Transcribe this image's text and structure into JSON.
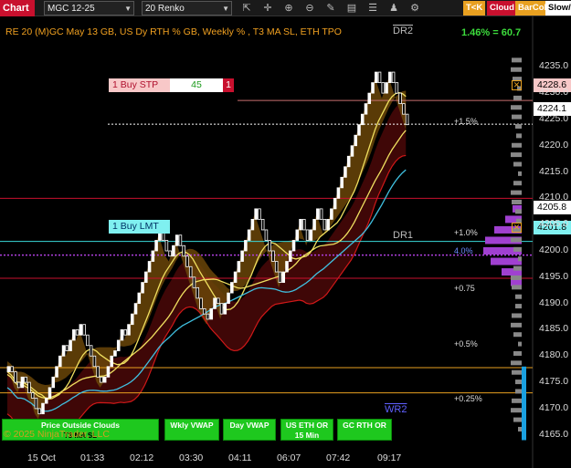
{
  "toolbar": {
    "chart_label": "Chart",
    "instrument": "MGC 12-25",
    "bar_type": "20 Renko",
    "icons": [
      "cursor-icon",
      "crosshair-icon",
      "draw-icon",
      "zoom-in-icon",
      "zoom-out-icon",
      "properties-icon",
      "list-icon",
      "strategy-icon",
      "settings-icon"
    ],
    "tk_label": "T<K",
    "cloud_label": "Cloud",
    "barcol_label": "BarCol",
    "slow_label": "Slow/I",
    "colors": {
      "chart": "#c8102e",
      "tk": "#e8a020",
      "cloud": "#c8102e",
      "barcol": "#e8a020"
    }
  },
  "header": {
    "title": "RE 20  (M)GC May 13 GB, US Dy RTH % GB, Weekly % , T3 MA SL, ETH TPO",
    "dr2": "DR2",
    "performance": "1.46% = 60.7"
  },
  "orders": {
    "buy_stop": {
      "label": "1 Buy STP",
      "qty": "45",
      "close": "1",
      "price": "4228.6"
    },
    "buy_limit": {
      "label": "1 Buy LMT",
      "price": "4201.8"
    }
  },
  "price_tags": {
    "last": "4224.1",
    "level_4205": "4205.8"
  },
  "y_axis": {
    "labels": [
      "4235.0",
      "4230.0",
      "4225.0",
      "4220.0",
      "4215.0",
      "4210.0",
      "4205.0",
      "4200.0",
      "4195.0",
      "4190.0",
      "4185.0",
      "4180.0",
      "4175.0",
      "4170.0",
      "4165.0"
    ],
    "min": 4162,
    "max": 4238
  },
  "x_axis": {
    "labels": [
      "15 Oct",
      "01:33",
      "02:12",
      "03:30",
      "04:11",
      "06:07",
      "07:42",
      "09:17"
    ]
  },
  "weekly_pct": [
    "+1.5%",
    "+1.0%",
    "4.0%",
    "+0.75",
    "+0.5%",
    "+0.25%"
  ],
  "labels": {
    "dr1": "DR1",
    "wr2": "WR2",
    "copyright": "© 2025 NinjaTrader, LLC"
  },
  "bottom_buttons": [
    {
      "label": "Price Outside Clouds"
    },
    {
      "label": "T3 MA SL"
    },
    {
      "label": "Wkly VWAP"
    },
    {
      "label": "Day VWAP"
    },
    {
      "label": "US ETH OR 15 Min"
    },
    {
      "label": "GC RTH OR"
    }
  ],
  "chart_data": {
    "type": "renko",
    "brick_size": 0.2,
    "bricks_close": [
      4178,
      4177,
      4175,
      4174,
      4176,
      4175,
      4173,
      4172,
      4170,
      4169,
      4171,
      4172,
      4174,
      4176,
      4178,
      4180,
      4182,
      4181,
      4183,
      4185,
      4184,
      4186,
      4184,
      4182,
      4180,
      4178,
      4176,
      4175,
      4176,
      4178,
      4180,
      4181,
      4183,
      4185,
      4184,
      4186,
      4188,
      4190,
      4192,
      4194,
      4196,
      4198,
      4200,
      4202,
      4204,
      4202,
      4200,
      4199,
      4201,
      4203,
      4201,
      4199,
      4197,
      4195,
      4193,
      4191,
      4189,
      4188,
      4187,
      4189,
      4191,
      4190,
      4188,
      4190,
      4192,
      4194,
      4196,
      4198,
      4200,
      4202,
      4204,
      4206,
      4208,
      4206,
      4204,
      4202,
      4200,
      4198,
      4196,
      4194,
      4196,
      4198,
      4200,
      4202,
      4204,
      4206,
      4204,
      4202,
      4204,
      4206,
      4208,
      4206,
      4204,
      4206,
      4208,
      4210,
      4212,
      4214,
      4216,
      4218,
      4220,
      4222,
      4224,
      4226,
      4228,
      4230,
      4232,
      4234,
      4232,
      4230,
      4232,
      4234,
      4232,
      4230,
      4228,
      4226,
      4224
    ],
    "levels": {
      "buy_stop": 4228.6,
      "last": 4224.1,
      "red_line_1": 4210.0,
      "buy_limit": 4201.8,
      "purple_dotted": 4199.2,
      "red_line_2": 4194.8,
      "orange_1": 4177.8,
      "orange_2": 4173.0
    }
  }
}
